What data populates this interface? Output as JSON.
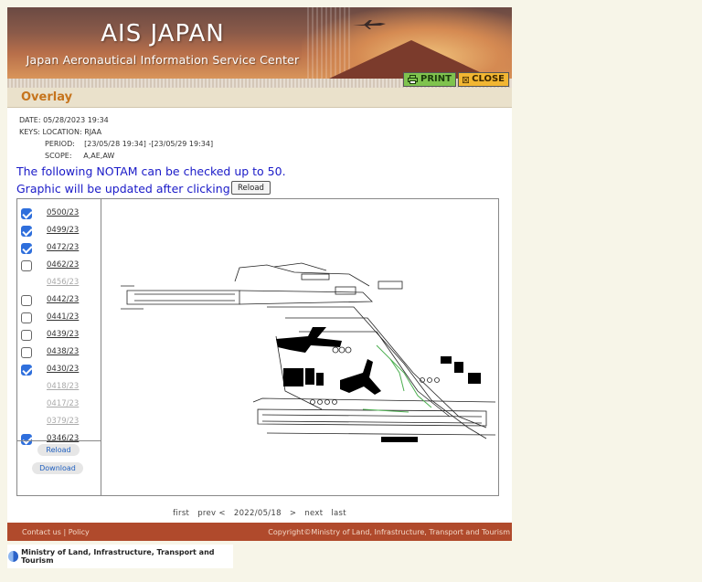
{
  "header": {
    "title": "AIS JAPAN",
    "subtitle": "Japan Aeronautical Information Service Center",
    "print_label": "PRINT",
    "close_label": "CLOSE"
  },
  "section": {
    "title": "Overlay"
  },
  "info": {
    "date_label": "DATE:",
    "date_value": "05/28/2023 19:34",
    "keys_label": "KEYS:",
    "location_label": "LOCATION:",
    "location_value": "RJAA",
    "period_label": "PERIOD:",
    "period_value": "[23/05/28 19:34] -[23/05/29 19:34]",
    "scope_label": "SCOPE:",
    "scope_value": "A,AE,AW"
  },
  "notice": {
    "line1": "The following NOTAM can be checked up to 50.",
    "line2": "Graphic will be updated after clicking",
    "reload_label": "Reload"
  },
  "notams": [
    {
      "id": "0500/23",
      "checked": true,
      "enabled": true
    },
    {
      "id": "0499/23",
      "checked": true,
      "enabled": true
    },
    {
      "id": "0472/23",
      "checked": true,
      "enabled": true
    },
    {
      "id": "0462/23",
      "checked": false,
      "enabled": true
    },
    {
      "id": "0456/23",
      "checked": false,
      "enabled": false
    },
    {
      "id": "0442/23",
      "checked": false,
      "enabled": true
    },
    {
      "id": "0441/23",
      "checked": false,
      "enabled": true
    },
    {
      "id": "0439/23",
      "checked": false,
      "enabled": true
    },
    {
      "id": "0438/23",
      "checked": false,
      "enabled": true
    },
    {
      "id": "0430/23",
      "checked": true,
      "enabled": true
    },
    {
      "id": "0418/23",
      "checked": false,
      "enabled": false
    },
    {
      "id": "0417/23",
      "checked": false,
      "enabled": false
    },
    {
      "id": "0379/23",
      "checked": false,
      "enabled": false
    },
    {
      "id": "0346/23",
      "checked": true,
      "enabled": true
    }
  ],
  "panel_buttons": {
    "reload": "Reload",
    "download": "Download"
  },
  "pager": {
    "first": "first",
    "prev": "prev",
    "lt": "<",
    "date": "2022/05/18",
    "gt": ">",
    "next": "next",
    "last": "last"
  },
  "footer": {
    "contact": "Contact us",
    "sep": "|",
    "policy": "Policy",
    "copyright": "Copyright©Ministry of Land, Infrastructure, Transport and Tourism"
  },
  "ministry": {
    "name": "Ministry of Land, Infrastructure, Transport and Tourism"
  },
  "colors": {
    "accent_orange": "#c6741d",
    "notice_blue": "#1a1ac8",
    "footer_bg": "#b04a2c",
    "checkbox_blue": "#2f6fdc",
    "taxiway_green": "#4caf50"
  }
}
